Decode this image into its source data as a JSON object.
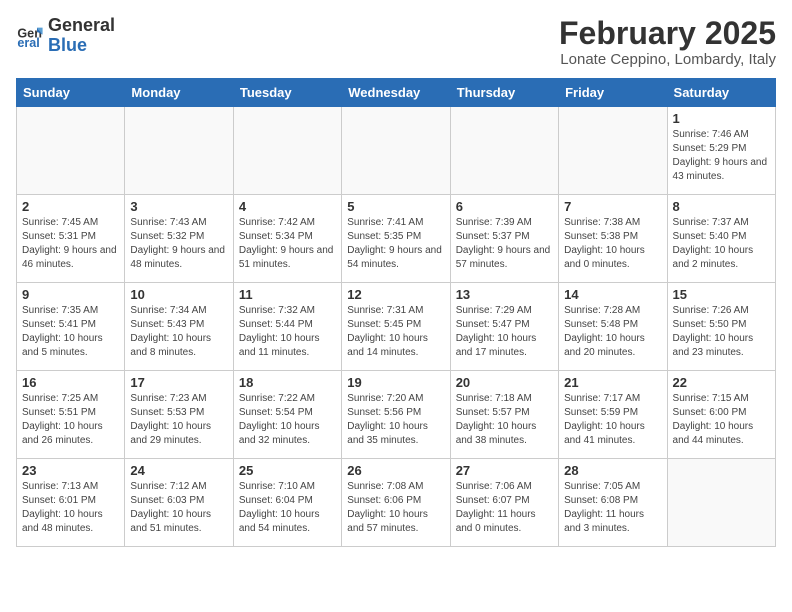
{
  "header": {
    "logo_line1": "General",
    "logo_line2": "Blue",
    "title": "February 2025",
    "subtitle": "Lonate Ceppino, Lombardy, Italy"
  },
  "days_of_week": [
    "Sunday",
    "Monday",
    "Tuesday",
    "Wednesday",
    "Thursday",
    "Friday",
    "Saturday"
  ],
  "weeks": [
    [
      {
        "day": "",
        "info": ""
      },
      {
        "day": "",
        "info": ""
      },
      {
        "day": "",
        "info": ""
      },
      {
        "day": "",
        "info": ""
      },
      {
        "day": "",
        "info": ""
      },
      {
        "day": "",
        "info": ""
      },
      {
        "day": "1",
        "info": "Sunrise: 7:46 AM\nSunset: 5:29 PM\nDaylight: 9 hours and 43 minutes."
      }
    ],
    [
      {
        "day": "2",
        "info": "Sunrise: 7:45 AM\nSunset: 5:31 PM\nDaylight: 9 hours and 46 minutes."
      },
      {
        "day": "3",
        "info": "Sunrise: 7:43 AM\nSunset: 5:32 PM\nDaylight: 9 hours and 48 minutes."
      },
      {
        "day": "4",
        "info": "Sunrise: 7:42 AM\nSunset: 5:34 PM\nDaylight: 9 hours and 51 minutes."
      },
      {
        "day": "5",
        "info": "Sunrise: 7:41 AM\nSunset: 5:35 PM\nDaylight: 9 hours and 54 minutes."
      },
      {
        "day": "6",
        "info": "Sunrise: 7:39 AM\nSunset: 5:37 PM\nDaylight: 9 hours and 57 minutes."
      },
      {
        "day": "7",
        "info": "Sunrise: 7:38 AM\nSunset: 5:38 PM\nDaylight: 10 hours and 0 minutes."
      },
      {
        "day": "8",
        "info": "Sunrise: 7:37 AM\nSunset: 5:40 PM\nDaylight: 10 hours and 2 minutes."
      }
    ],
    [
      {
        "day": "9",
        "info": "Sunrise: 7:35 AM\nSunset: 5:41 PM\nDaylight: 10 hours and 5 minutes."
      },
      {
        "day": "10",
        "info": "Sunrise: 7:34 AM\nSunset: 5:43 PM\nDaylight: 10 hours and 8 minutes."
      },
      {
        "day": "11",
        "info": "Sunrise: 7:32 AM\nSunset: 5:44 PM\nDaylight: 10 hours and 11 minutes."
      },
      {
        "day": "12",
        "info": "Sunrise: 7:31 AM\nSunset: 5:45 PM\nDaylight: 10 hours and 14 minutes."
      },
      {
        "day": "13",
        "info": "Sunrise: 7:29 AM\nSunset: 5:47 PM\nDaylight: 10 hours and 17 minutes."
      },
      {
        "day": "14",
        "info": "Sunrise: 7:28 AM\nSunset: 5:48 PM\nDaylight: 10 hours and 20 minutes."
      },
      {
        "day": "15",
        "info": "Sunrise: 7:26 AM\nSunset: 5:50 PM\nDaylight: 10 hours and 23 minutes."
      }
    ],
    [
      {
        "day": "16",
        "info": "Sunrise: 7:25 AM\nSunset: 5:51 PM\nDaylight: 10 hours and 26 minutes."
      },
      {
        "day": "17",
        "info": "Sunrise: 7:23 AM\nSunset: 5:53 PM\nDaylight: 10 hours and 29 minutes."
      },
      {
        "day": "18",
        "info": "Sunrise: 7:22 AM\nSunset: 5:54 PM\nDaylight: 10 hours and 32 minutes."
      },
      {
        "day": "19",
        "info": "Sunrise: 7:20 AM\nSunset: 5:56 PM\nDaylight: 10 hours and 35 minutes."
      },
      {
        "day": "20",
        "info": "Sunrise: 7:18 AM\nSunset: 5:57 PM\nDaylight: 10 hours and 38 minutes."
      },
      {
        "day": "21",
        "info": "Sunrise: 7:17 AM\nSunset: 5:59 PM\nDaylight: 10 hours and 41 minutes."
      },
      {
        "day": "22",
        "info": "Sunrise: 7:15 AM\nSunset: 6:00 PM\nDaylight: 10 hours and 44 minutes."
      }
    ],
    [
      {
        "day": "23",
        "info": "Sunrise: 7:13 AM\nSunset: 6:01 PM\nDaylight: 10 hours and 48 minutes."
      },
      {
        "day": "24",
        "info": "Sunrise: 7:12 AM\nSunset: 6:03 PM\nDaylight: 10 hours and 51 minutes."
      },
      {
        "day": "25",
        "info": "Sunrise: 7:10 AM\nSunset: 6:04 PM\nDaylight: 10 hours and 54 minutes."
      },
      {
        "day": "26",
        "info": "Sunrise: 7:08 AM\nSunset: 6:06 PM\nDaylight: 10 hours and 57 minutes."
      },
      {
        "day": "27",
        "info": "Sunrise: 7:06 AM\nSunset: 6:07 PM\nDaylight: 11 hours and 0 minutes."
      },
      {
        "day": "28",
        "info": "Sunrise: 7:05 AM\nSunset: 6:08 PM\nDaylight: 11 hours and 3 minutes."
      },
      {
        "day": "",
        "info": ""
      }
    ]
  ]
}
